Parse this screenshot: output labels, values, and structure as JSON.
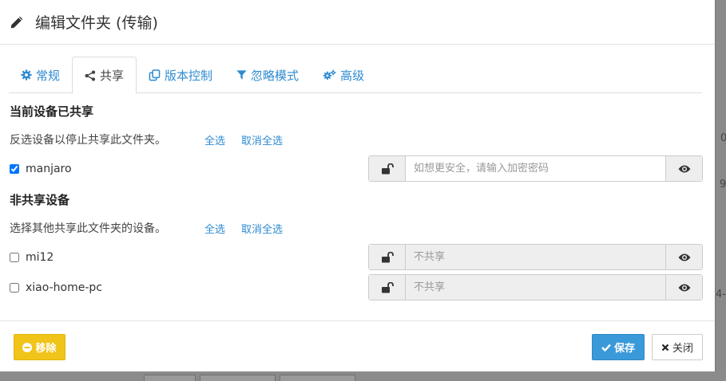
{
  "dialog": {
    "title": "编辑文件夹 (传输)"
  },
  "tabs": [
    {
      "label": "常规",
      "icon": "gear-icon"
    },
    {
      "label": "共享",
      "icon": "share-icon"
    },
    {
      "label": "版本控制",
      "icon": "copy-icon"
    },
    {
      "label": "忽略模式",
      "icon": "filter-icon"
    },
    {
      "label": "高级",
      "icon": "cogs-icon"
    }
  ],
  "active_tab": "共享",
  "shared": {
    "heading": "当前设备已共享",
    "hint": "反选设备以停止共享此文件夹。",
    "select_all": "全选",
    "deselect_all": "取消全选",
    "devices": [
      {
        "name": "manjaro",
        "checked": true,
        "password_placeholder": "如想更安全，请输入加密密码",
        "disabled": false
      }
    ]
  },
  "unshared": {
    "heading": "非共享设备",
    "hint": "选择其他共享此文件夹的设备。",
    "select_all": "全选",
    "deselect_all": "取消全选",
    "devices": [
      {
        "name": "mi12",
        "checked": false,
        "password_placeholder": "不共享",
        "disabled": true
      },
      {
        "name": "xiao-home-pc",
        "checked": false,
        "password_placeholder": "不共享",
        "disabled": true
      }
    ]
  },
  "footer": {
    "remove_label": "移除",
    "save_label": "保存",
    "close_label": "关闭"
  },
  "background": {
    "frag1": "0",
    "frag2": "9",
    "frag3": "4-"
  },
  "colors": {
    "link": "#2f8bd1",
    "remove": "#f0c419",
    "save": "#3a9ad9"
  }
}
